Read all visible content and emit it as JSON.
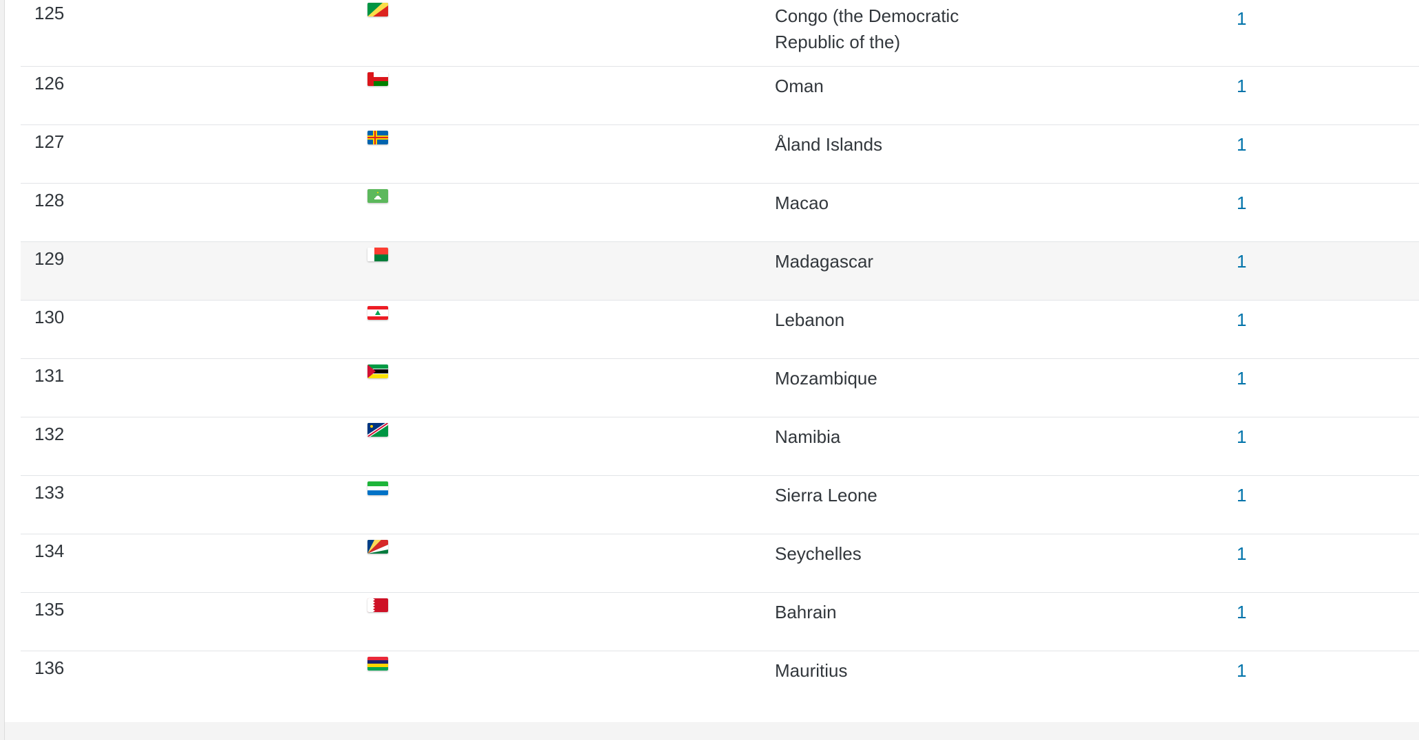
{
  "rows": [
    {
      "rank": "125",
      "flag": "congo-flag-icon",
      "country": "Congo (the Democratic Republic of the)",
      "count": "1"
    },
    {
      "rank": "126",
      "flag": "oman-flag-icon",
      "country": "Oman",
      "count": "1"
    },
    {
      "rank": "127",
      "flag": "aland-islands-flag-icon",
      "country": "Åland Islands",
      "count": "1"
    },
    {
      "rank": "128",
      "flag": "macao-flag-icon",
      "country": "Macao",
      "count": "1"
    },
    {
      "rank": "129",
      "flag": "madagascar-flag-icon",
      "country": "Madagascar",
      "count": "1"
    },
    {
      "rank": "130",
      "flag": "lebanon-flag-icon",
      "country": "Lebanon",
      "count": "1"
    },
    {
      "rank": "131",
      "flag": "mozambique-flag-icon",
      "country": "Mozambique",
      "count": "1"
    },
    {
      "rank": "132",
      "flag": "namibia-flag-icon",
      "country": "Namibia",
      "count": "1"
    },
    {
      "rank": "133",
      "flag": "sierra-leone-flag-icon",
      "country": "Sierra Leone",
      "count": "1"
    },
    {
      "rank": "134",
      "flag": "seychelles-flag-icon",
      "country": "Seychelles",
      "count": "1"
    },
    {
      "rank": "135",
      "flag": "bahrain-flag-icon",
      "country": "Bahrain",
      "count": "1"
    },
    {
      "rank": "136",
      "flag": "mauritius-flag-icon",
      "country": "Mauritius",
      "count": "1"
    }
  ],
  "colors": {
    "link": "#0073aa",
    "text": "#32373c",
    "row_border": "#e2e4e7",
    "row_hover": "#f6f6f6"
  }
}
